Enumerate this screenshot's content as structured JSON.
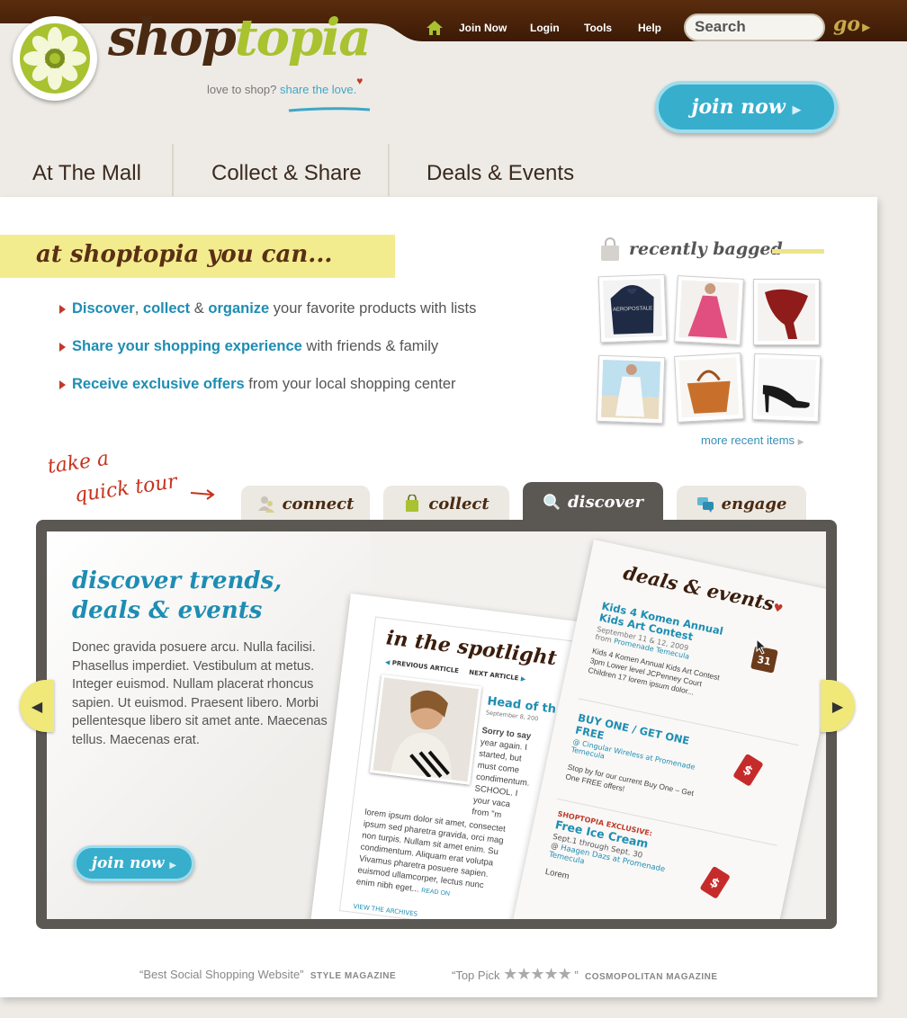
{
  "brand": {
    "name_part1": "shop",
    "name_part2": "topia",
    "tagline_prefix": "love to shop?",
    "tagline_highlight": "share the love."
  },
  "topnav": {
    "join": "Join Now",
    "login": "Login",
    "tools": "Tools",
    "help": "Help"
  },
  "search": {
    "placeholder": "Search",
    "go": "go"
  },
  "hero": {
    "join_button": "join now"
  },
  "mainnav": [
    "At The Mall",
    "Collect & Share",
    "Deals & Events"
  ],
  "intro": {
    "banner": "at shoptopia you can...",
    "bullets": [
      {
        "parts": [
          {
            "t": "Discover",
            "h": true
          },
          {
            "t": ", ",
            "h": false
          },
          {
            "t": "collect",
            "h": true
          },
          {
            "t": " & ",
            "h": false
          },
          {
            "t": "organize",
            "h": true
          },
          {
            "t": " your favorite products with lists",
            "h": false
          }
        ]
      },
      {
        "parts": [
          {
            "t": "Share your shopping experience",
            "h": true
          },
          {
            "t": " with friends & family",
            "h": false
          }
        ]
      },
      {
        "parts": [
          {
            "t": "Receive exclusive offers",
            "h": true
          },
          {
            "t": " from your local shopping center",
            "h": false
          }
        ]
      }
    ]
  },
  "recently_bagged": {
    "title": "recently bagged",
    "more_link": "more recent items",
    "items": [
      "hoodie",
      "pink dress",
      "red scarf",
      "white cover-up",
      "orange handbag",
      "black heels"
    ],
    "thumb_hoodie_text": "AEROPOSTALE"
  },
  "tour": {
    "prompt_line1": "take a",
    "prompt_line2": "quick tour",
    "tabs": [
      "connect",
      "collect",
      "discover",
      "engage"
    ],
    "active_tab": "discover",
    "heading_line1": "discover trends,",
    "heading_line2": "deals & events",
    "body": "Donec gravida posuere arcu. Nulla facilisi. Phasellus imperdiet. Vestibulum at metus. Integer euismod. Nullam placerat rhoncus sapien. Ut euismod. Praesent libero. Morbi pellentesque libero sit amet ante. Maecenas tellus. Maecenas erat.",
    "join_button": "join now"
  },
  "spotlight": {
    "title": "in the spotlight",
    "prev": "PREVIOUS ARTICLE",
    "next": "NEXT ARTICLE",
    "head": "Head of th",
    "date": "September 8, 200",
    "side_lines": [
      "Sorry to say",
      "year again. I",
      "started, but",
      "must come",
      "condimentum.",
      "SCHOOL. I",
      "your vaca",
      "from \"m"
    ],
    "body_lines": [
      "lorem ipsum dolor sit amet, consectet",
      "ipsum sed pharetra gravida, orci mag",
      "non turpis. Nullam sit amet enim. Su",
      "condimentum. Aliquam erat volutpa",
      "Vivamus pharetra posuere sapien.",
      "euismod ullamcorper, lectus nunc",
      "enim nibh eget..."
    ],
    "read_on": "READ ON",
    "archives": "VIEW THE ARCHIVES"
  },
  "deals": {
    "title": "deals & events",
    "calendar_day": "31",
    "items": [
      {
        "label": "",
        "title": "Kids 4 Komen Annual Kids Art Contest",
        "sub1": "September 11 & 12, 2009",
        "sub2_prefix": "from",
        "sub2": "Promenade Temecula",
        "body": "Kids 4 Komen Annual Kids Art Contest 3pm Lower level JCPenney Court Children 17 lorem ipsum dolor..."
      },
      {
        "label": "",
        "title": "BUY ONE / GET ONE FREE",
        "sub1": "@ Cingular Wireless at Promenade Temecula",
        "sub2_prefix": "",
        "sub2": "",
        "body": "Stop by for our current Buy One – Get One FREE offers!"
      },
      {
        "label": "SHOPTOPIA EXCLUSIVE:",
        "title": "Free Ice Cream",
        "sub1": "Sept.1 through Sept. 30",
        "sub2_prefix": "@",
        "sub2": "Haagen Dazs at Promenade Temecula",
        "body": "Lorem"
      }
    ]
  },
  "quotes": [
    {
      "text": "“Best Social Shopping Website”",
      "source": "STYLE MAGAZINE"
    },
    {
      "text_open": "“Top Pick",
      "text_close": "”",
      "stars": 5,
      "source": "COSMOPOLITAN MAGAZINE"
    }
  ],
  "colors": {
    "brown": "#4a2a12",
    "accent_blue": "#1e8db3",
    "lime": "#a8c230",
    "banner_yellow": "#f3ec8e"
  }
}
